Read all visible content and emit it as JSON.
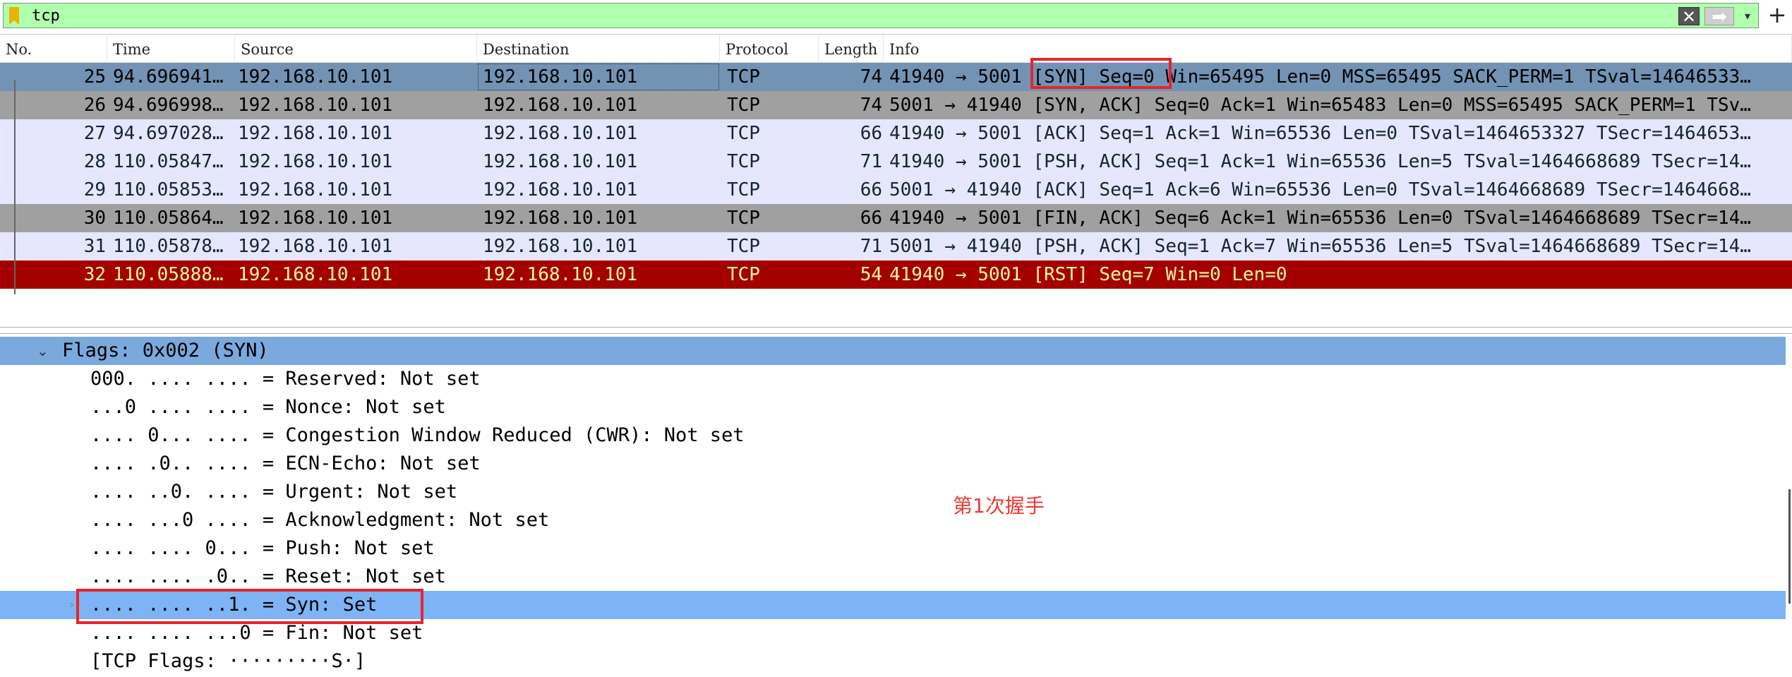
{
  "filter": {
    "value": "tcp",
    "clear_icon": "clear-x-icon",
    "apply_icon": "arrow-right-icon",
    "dropdown_icon": "chevron-down-icon",
    "add_icon": "plus-icon"
  },
  "columns": [
    "No.",
    "Time",
    "Source",
    "Destination",
    "Protocol",
    "Length",
    "Info"
  ],
  "packets": [
    {
      "no": "25",
      "time": "94.696941…",
      "source": "192.168.10.101",
      "destination": "192.168.10.101",
      "protocol": "TCP",
      "length": "74",
      "info": "41940 → 5001 [SYN] Seq=0 Win=65495 Len=0 MSS=65495 SACK_PERM=1 TSval=14646533…"
    },
    {
      "no": "26",
      "time": "94.696998…",
      "source": "192.168.10.101",
      "destination": "192.168.10.101",
      "protocol": "TCP",
      "length": "74",
      "info": "5001 → 41940 [SYN, ACK] Seq=0 Ack=1 Win=65483 Len=0 MSS=65495 SACK_PERM=1 TSv…"
    },
    {
      "no": "27",
      "time": "94.697028…",
      "source": "192.168.10.101",
      "destination": "192.168.10.101",
      "protocol": "TCP",
      "length": "66",
      "info": "41940 → 5001 [ACK] Seq=1 Ack=1 Win=65536 Len=0 TSval=1464653327 TSecr=1464653…"
    },
    {
      "no": "28",
      "time": "110.05847…",
      "source": "192.168.10.101",
      "destination": "192.168.10.101",
      "protocol": "TCP",
      "length": "71",
      "info": "41940 → 5001 [PSH, ACK] Seq=1 Ack=1 Win=65536 Len=5 TSval=1464668689 TSecr=14…"
    },
    {
      "no": "29",
      "time": "110.05853…",
      "source": "192.168.10.101",
      "destination": "192.168.10.101",
      "protocol": "TCP",
      "length": "66",
      "info": "5001 → 41940 [ACK] Seq=1 Ack=6 Win=65536 Len=0 TSval=1464668689 TSecr=1464668…"
    },
    {
      "no": "30",
      "time": "110.05864…",
      "source": "192.168.10.101",
      "destination": "192.168.10.101",
      "protocol": "TCP",
      "length": "66",
      "info": "41940 → 5001 [FIN, ACK] Seq=6 Ack=1 Win=65536 Len=0 TSval=1464668689 TSecr=14…"
    },
    {
      "no": "31",
      "time": "110.05878…",
      "source": "192.168.10.101",
      "destination": "192.168.10.101",
      "protocol": "TCP",
      "length": "71",
      "info": "5001 → 41940 [PSH, ACK] Seq=1 Ack=7 Win=65536 Len=5 TSval=1464668689 TSecr=14…"
    },
    {
      "no": "32",
      "time": "110.05888…",
      "source": "192.168.10.101",
      "destination": "192.168.10.101",
      "protocol": "TCP",
      "length": "54",
      "info": "41940 → 5001 [RST] Seq=7 Win=0 Len=0"
    }
  ],
  "row_colors": {
    "selected_bg": "#7393b5",
    "selected_fg": "#000000",
    "gray_bg": "#a0a0a0",
    "gray_fg": "#000000",
    "lavender_bg": "#e7e6ff",
    "lavender_fg": "#12272e",
    "rst_bg": "#a40000",
    "rst_fg": "#fffc9c"
  },
  "details": {
    "header": "Flags: 0x002 (SYN)",
    "lines": [
      "000. .... .... = Reserved: Not set",
      "...0 .... .... = Nonce: Not set",
      ".... 0... .... = Congestion Window Reduced (CWR): Not set",
      ".... .0.. .... = ECN-Echo: Not set",
      ".... ..0. .... = Urgent: Not set",
      ".... ...0 .... = Acknowledgment: Not set",
      ".... .... 0... = Push: Not set",
      ".... .... .0.. = Reset: Not set",
      ".... .... ..1. = Syn: Set",
      ".... .... ...0 = Fin: Not set",
      "[TCP Flags: ·········S·]"
    ]
  },
  "annotation": {
    "text": "第1次握手",
    "color": "#ee3a30"
  }
}
